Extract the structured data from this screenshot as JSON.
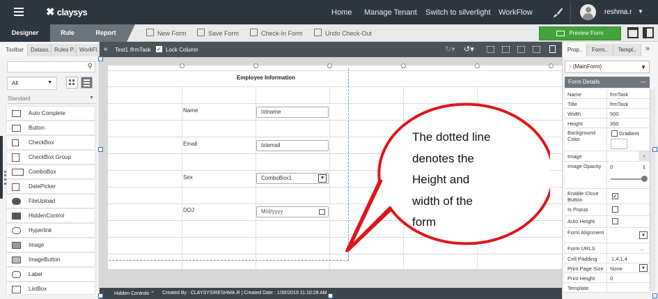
{
  "topbar": {
    "logo": "claysys",
    "nav": [
      "Home",
      "Manage Tenant",
      "Switch to silverlight",
      "WorkFlow"
    ],
    "username": "reshma.r"
  },
  "tabs": [
    "Designer",
    "Rule",
    "Report"
  ],
  "toolbar": {
    "new_form": "New Form",
    "save_form": "Save Form",
    "check_in": "Check-In Form",
    "undo_checkout": "Undo Check-Out",
    "preview": "Preview Form"
  },
  "left_panel": {
    "tabs": [
      "Toolbar",
      "Dataso..",
      "Rules P..",
      "WorkFl.."
    ],
    "filter": "All",
    "section": "Standard",
    "items": [
      "Auto Complete",
      "Button",
      "CheckBox",
      "CheckBox Group",
      "ComboBox",
      "DatePicker",
      "FileUpload",
      "HiddenControl",
      "Hyperlink",
      "Image",
      "ImageButton",
      "Label",
      "ListBox"
    ]
  },
  "canvas": {
    "breadcrumb": "Test1 /frmTask",
    "lock_column": "Lock Column",
    "form_title": "Employee Information",
    "fields": [
      {
        "label": "Name",
        "value": "txtname"
      },
      {
        "label": "Email",
        "value": "txtemail"
      },
      {
        "label": "Sex",
        "value": "ComboBox1"
      },
      {
        "label": "DOJ",
        "value": "M/d/yyyy"
      }
    ]
  },
  "callout": {
    "lines": [
      "The dotted line",
      "denotes the",
      "Height and",
      "width of the",
      "form"
    ]
  },
  "statusbar": {
    "hidden_controls": "Hidden Controls",
    "created": "Created By : CLAYSYS\\RESHMA.R | Created Date : 1/30/2019 11:10:28 AM"
  },
  "right_panel": {
    "tabs": [
      "Prop..",
      "Form..",
      "Templ.."
    ],
    "selected": "- (MainForm)",
    "section": "Form Details",
    "props": [
      {
        "key": "Name",
        "value": "frmTask"
      },
      {
        "key": "Title",
        "value": "frmTask"
      },
      {
        "key": "Width",
        "value": "500"
      },
      {
        "key": "Height",
        "value": "350"
      },
      {
        "key": "Background Color",
        "value": "Gradient"
      },
      {
        "key": "Image",
        "value": ""
      },
      {
        "key": "Image Opacity",
        "value": "0",
        "value2": "1"
      },
      {
        "key": "Enable Close Button",
        "value": ""
      },
      {
        "key": "Is Popup",
        "value": ""
      },
      {
        "key": "Auto Height",
        "value": ""
      },
      {
        "key": "Form Alignment",
        "value": ""
      },
      {
        "key": "Form URLS",
        "value": "..."
      },
      {
        "key": "Cell Padding",
        "value": "1,4,1,4"
      },
      {
        "key": "Print Page Size",
        "value": "None"
      },
      {
        "key": "Print Height",
        "value": "0"
      },
      {
        "key": "Template",
        "value": ""
      }
    ]
  },
  "colors": {
    "topbar": "#2e3740",
    "preview": "#43a23c",
    "callout_border": "#e0151c",
    "active_tab": "#2e3740"
  }
}
